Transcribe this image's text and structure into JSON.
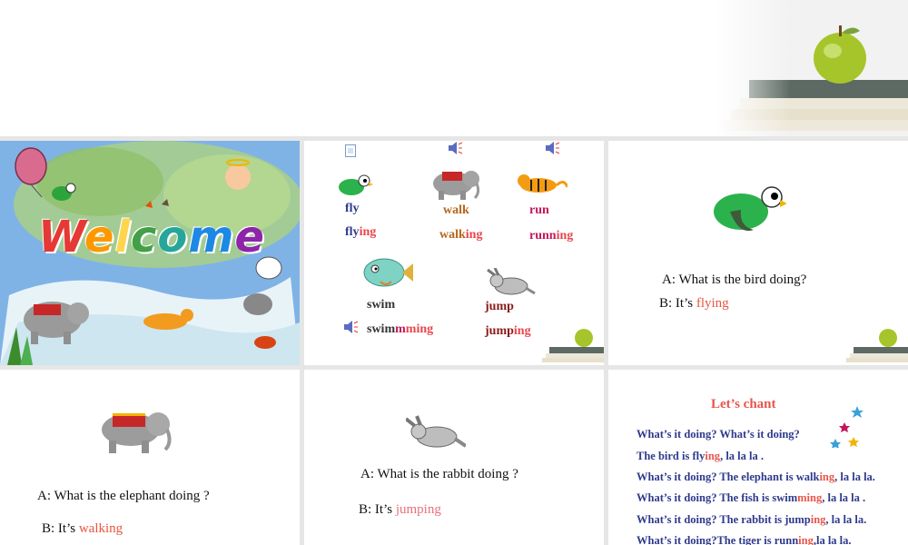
{
  "slide1": {
    "welcome": [
      "W",
      "e",
      "l",
      "c",
      "o",
      "m",
      "e"
    ],
    "welcome_colors": [
      "#e53935",
      "#ff9800",
      "#ffd54f",
      "#43a047",
      "#26a69a",
      "#1e88e5",
      "#8e24aa"
    ]
  },
  "slide2": {
    "fly": "fly",
    "flying_base": "fly",
    "flying_ing": "ing",
    "walk": "walk",
    "walking_base": "walk",
    "walking_ing": "ing",
    "run": "run",
    "running_base": "runn",
    "running_ing": "ing",
    "swim": "swim",
    "swimming_base": "swim",
    "swimming_mm": "m",
    "swimming_ing": "ming",
    "jump": "jump",
    "jumping_base": "jump",
    "jumping_ing": "ing",
    "colors": {
      "fly": "#2e3a8c",
      "walk": "#b5651d",
      "run": "#c2185b",
      "swim": "#333333",
      "jump": "#8b1a1a"
    }
  },
  "slide3": {
    "question": "A: What is the bird doing?",
    "answer_prefix": "B: It’s ",
    "answer": "flying"
  },
  "slide4": {
    "question": "A: What is the elephant doing ?",
    "answer_prefix": "B: It’s ",
    "answer": "walking"
  },
  "slide5": {
    "question": "A: What is the rabbit doing ?",
    "answer_prefix": "B: It’s ",
    "answer": "jumping"
  },
  "slide6": {
    "title": "Let’s  chant",
    "lines": [
      {
        "pre": "What’s it doing?   What’s it doing?",
        "ing": "",
        "post": ""
      },
      {
        "pre": "The bird is fly",
        "ing": "ing",
        "post": ", la la la ."
      },
      {
        "pre": "What’s it doing? The elephant is walk",
        "ing": "ing",
        "post": ", la la la."
      },
      {
        "pre": "What’s it doing? The fish is swim",
        "ing": "ming",
        "post": ", la la la ."
      },
      {
        "pre": "What’s it doing? The rabbit is jump",
        "ing": "ing",
        "post": ", la la la."
      },
      {
        "pre": "What’s it doing?The tiger is runn",
        "ing": "ing",
        "post": ",la la la."
      }
    ]
  },
  "accent": "#e8454b"
}
